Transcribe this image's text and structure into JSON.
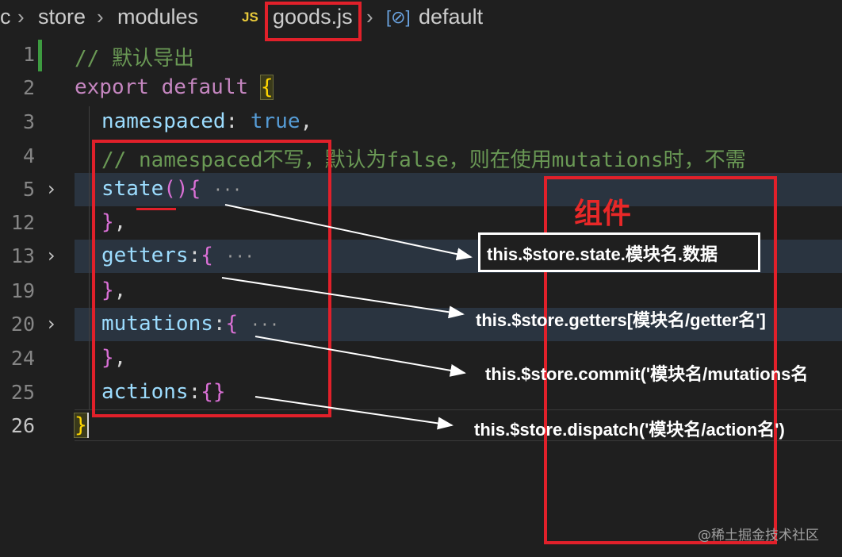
{
  "breadcrumb": {
    "segments": [
      "c",
      "store",
      "modules",
      "goods.js",
      "default"
    ],
    "file_icon": "JS",
    "symbol_icon": "[⊘]"
  },
  "editor": {
    "lines": [
      {
        "number": "1",
        "text": "// 默认导出"
      },
      {
        "number": "2",
        "text": "export default {"
      },
      {
        "number": "3",
        "text": "namespaced: true,"
      },
      {
        "number": "4",
        "text": "// namespaced不写，默认为false，则在使用mutations时，不需"
      },
      {
        "number": "5",
        "text": "state(){ ···"
      },
      {
        "number": "12",
        "text": "},"
      },
      {
        "number": "13",
        "text": "getters:{ ···"
      },
      {
        "number": "19",
        "text": "},"
      },
      {
        "number": "20",
        "text": "mutations:{ ···"
      },
      {
        "number": "24",
        "text": "},"
      },
      {
        "number": "25",
        "text": "actions:{}"
      },
      {
        "number": "26",
        "text": "}"
      }
    ]
  },
  "annotations": {
    "component_title": "组件",
    "state_access": "this.$store.state.模块名.数据",
    "getters_access": "this.$store.getters[模块名/getter名']",
    "mutations_access": "this.$store.commit('模块名/mutations名",
    "actions_access": "this.$store.dispatch('模块名/action名')",
    "annotation_color": "#e1202a"
  },
  "watermark": "@稀土掘金技术社区"
}
